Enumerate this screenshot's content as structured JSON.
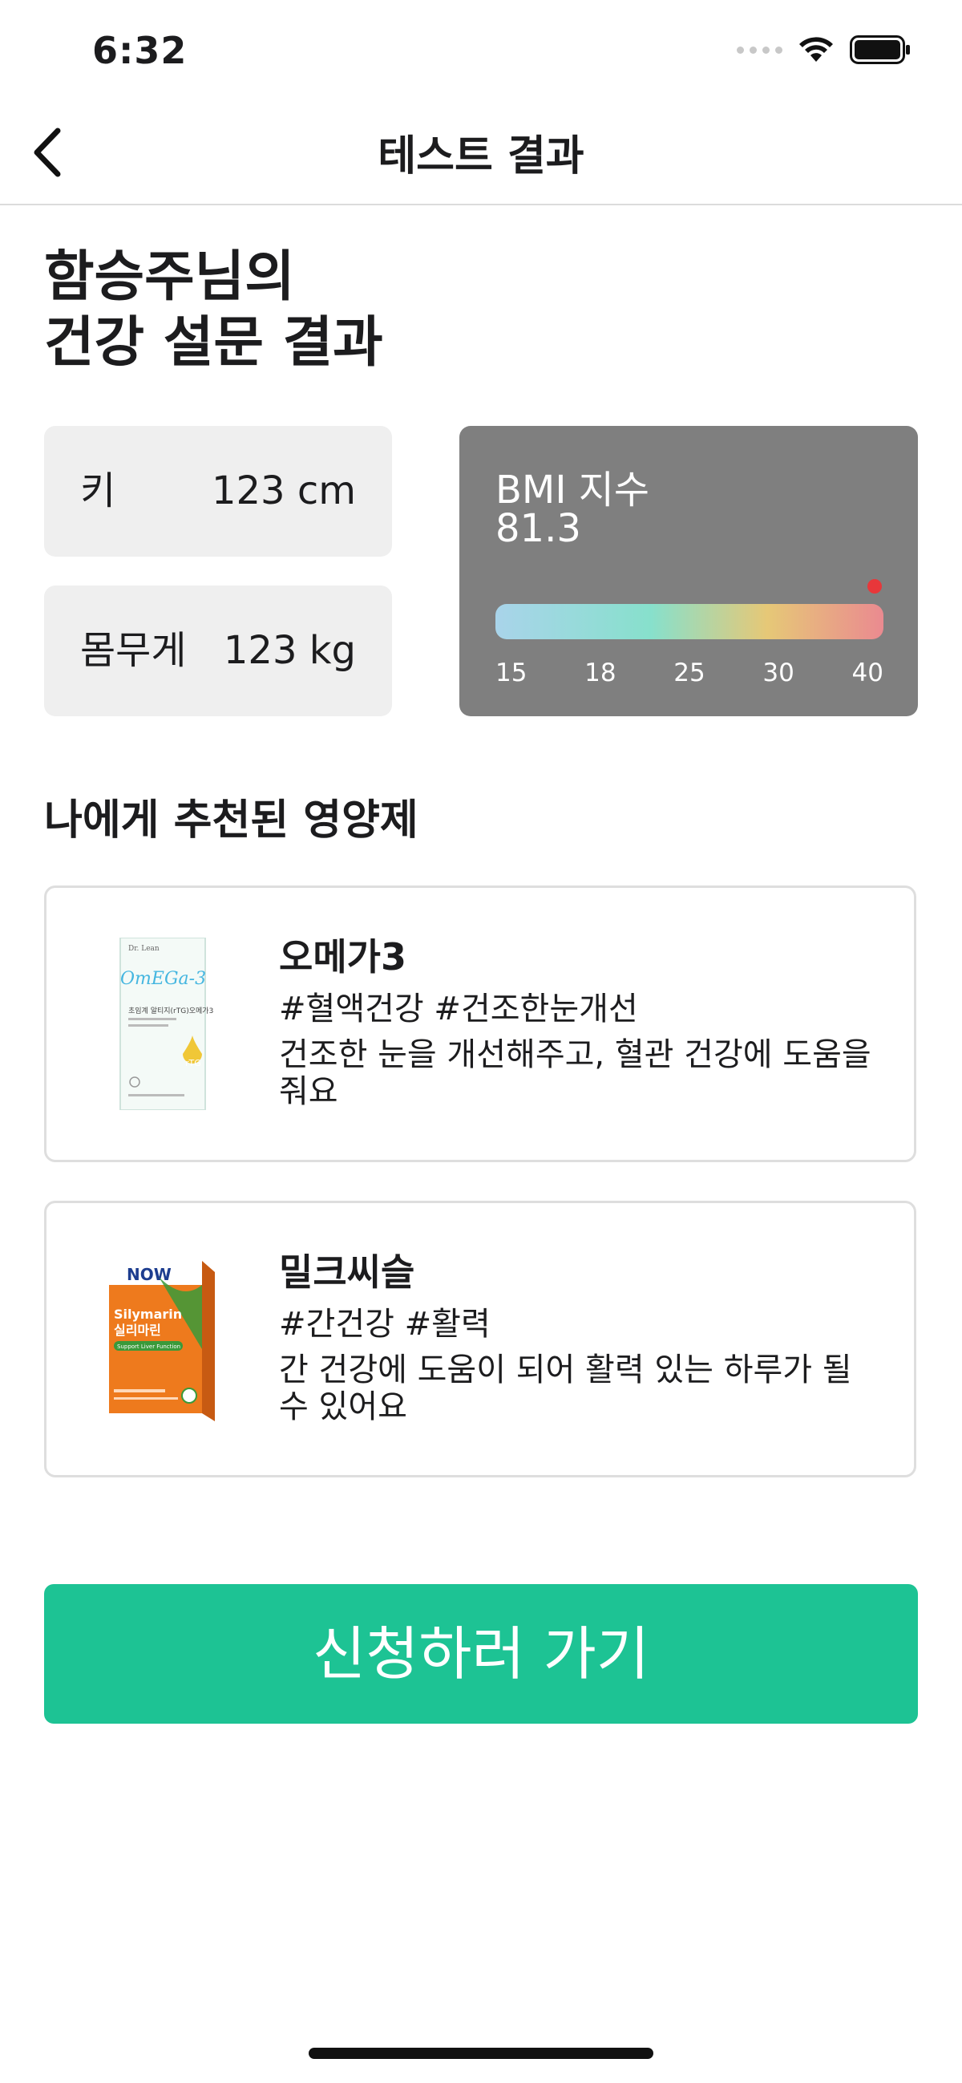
{
  "status_bar": {
    "time": "6:32"
  },
  "nav": {
    "title": "테스트 결과"
  },
  "page_title": "함승주님의\n건강 설문 결과",
  "stats": {
    "height": {
      "label": "키",
      "value": "123 cm"
    },
    "weight": {
      "label": "몸무게",
      "value": "123 kg"
    }
  },
  "bmi": {
    "label": "BMI 지수",
    "value": "81.3",
    "scale": [
      "15",
      "18",
      "25",
      "30",
      "40"
    ],
    "marker_fraction": 1.0,
    "marker_color": "#e8373a"
  },
  "section_title": "나에게 추천된 영양제",
  "products": [
    {
      "name": "오메가3",
      "tags": "#혈액건강 #건조한눈개선",
      "description": "건조한 눈을 개선해주고, 혈관 건강에 도움을 줘요",
      "image": {
        "brand": "Dr. Lean",
        "logo_text": "OmEGa-3",
        "text": "초임계 알티지(rTG)오메가3",
        "badge": "rTG"
      }
    },
    {
      "name": "밀크씨슬",
      "tags": "#간건강 #활력",
      "description": "간 건강에 도움이 되어 활력 있는 하루가 될 수 있어요",
      "image": {
        "brand": "NOW",
        "title_en": "Silymarin",
        "title_ko": "실리마린",
        "band": "Support Liver Function"
      }
    }
  ],
  "cta_label": "신청하러 가기",
  "colors": {
    "accent": "#1dc394",
    "bmi_card": "#7f7f7f",
    "stat_card": "#efefef"
  }
}
